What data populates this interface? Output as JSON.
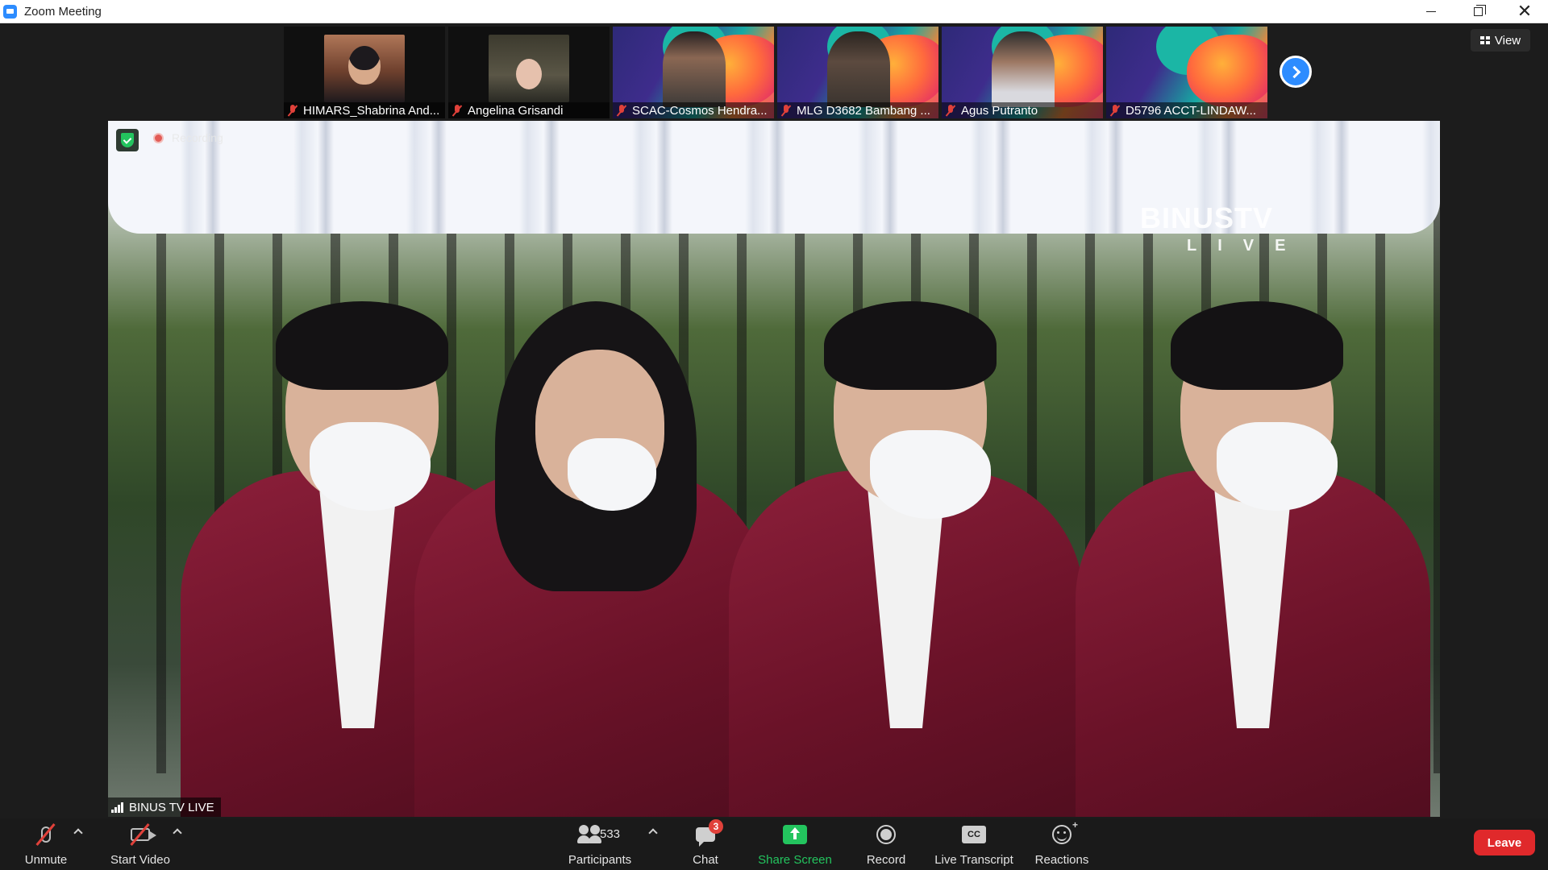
{
  "window": {
    "title": "Zoom Meeting"
  },
  "gallery": {
    "tiles": [
      {
        "name": "HIMARS_Shabrina And..."
      },
      {
        "name": "Angelina Grisandi"
      },
      {
        "name": "SCAC-Cosmos Hendra..."
      },
      {
        "name": "MLG D3682 Bambang ..."
      },
      {
        "name": "Agus Putranto"
      },
      {
        "name": "D5796 ACCT-LINDAW..."
      }
    ],
    "view_label": "View"
  },
  "main_video": {
    "recording_label": "Recording",
    "speaker_name": "BINUS TV LIVE",
    "watermark_main": "BINUSTV",
    "watermark_sub": "LIVE"
  },
  "toolbar": {
    "unmute": "Unmute",
    "start_video": "Start Video",
    "participants": "Participants",
    "participants_count": "533",
    "chat": "Chat",
    "chat_badge": "3",
    "share_screen": "Share Screen",
    "record": "Record",
    "live_transcript": "Live Transcript",
    "cc_glyph": "CC",
    "reactions": "Reactions",
    "leave": "Leave"
  },
  "colors": {
    "zoom_blue": "#2d8cff",
    "leave_red": "#e0292b",
    "share_green": "#23c45e",
    "muted_red": "#e0413a",
    "jacket_maroon": "#8c1f3a"
  }
}
